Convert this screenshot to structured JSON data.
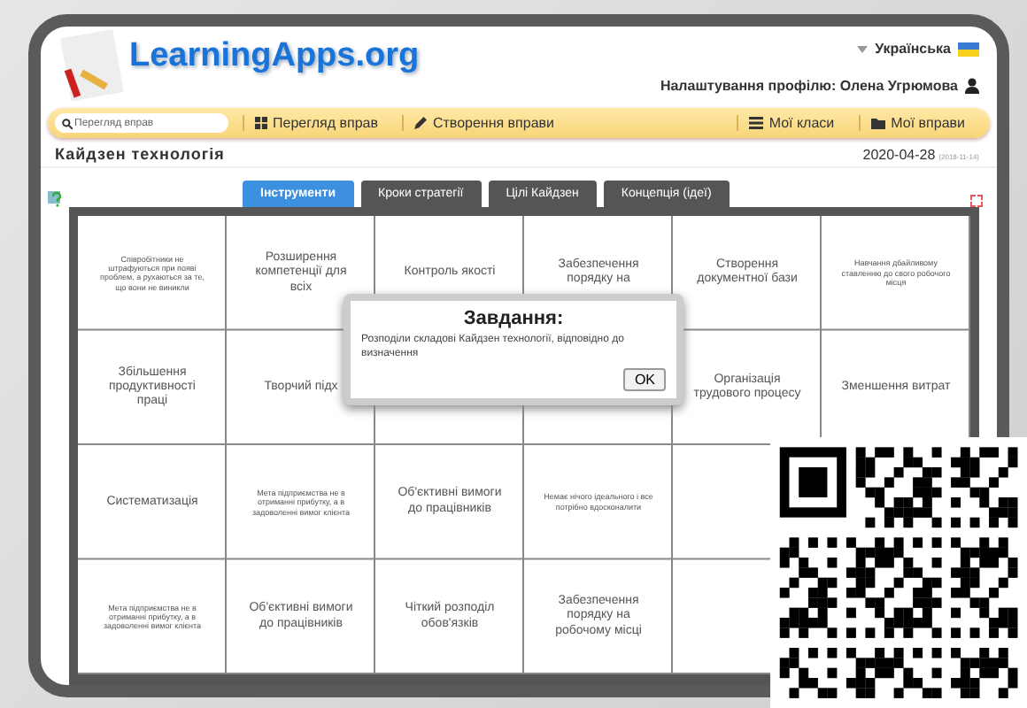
{
  "header": {
    "logo": "LearningApps.org",
    "language": "Українська",
    "profile": "Налаштування профілю: Олена Угрюмова"
  },
  "nav": {
    "search": {
      "placeholder": "Перегляд вправ"
    },
    "links": [
      {
        "label": "Перегляд вправ",
        "kind": "grid"
      },
      {
        "label": "Створення вправи",
        "kind": "pencil"
      },
      {
        "label": "Мої класи",
        "kind": "list"
      },
      {
        "label": "Мої вправи",
        "kind": "folder"
      }
    ]
  },
  "page": {
    "title": "Кайдзен технологія",
    "date": "2020-04-28",
    "created": "(2018-11-14)"
  },
  "tabs": [
    {
      "label": "Інструменти",
      "selected": true
    },
    {
      "label": "Кроки стратегії",
      "selected": false
    },
    {
      "label": "Цілі Кайдзен",
      "selected": false
    },
    {
      "label": "Концепція (ідеї)",
      "selected": false
    }
  ],
  "puzzle": [
    [
      {
        "text": "Співробітники не штрафуються при появі проблем, а рухаються за те, що вони не виникли",
        "kind": "small"
      },
      {
        "text": "Розширення компетенції для всіх",
        "kind": "normal"
      },
      {
        "text": "Контроль якості",
        "kind": "normal"
      },
      {
        "text": "Забезпечення порядку на",
        "kind": "normal"
      },
      {
        "text": "Створення документної бази",
        "kind": "normal"
      },
      {
        "text": "Навчання дбайливому ставленню до свого робочого місця",
        "kind": "small"
      }
    ],
    [
      {
        "text": "Збільшення продуктивності праці",
        "kind": "normal"
      },
      {
        "text": "Творчий підх",
        "kind": "normal"
      },
      {
        "kind": "covered"
      },
      {
        "kind": "covered"
      },
      {
        "text": "Організація трудового процесу",
        "kind": "normal"
      },
      {
        "text": "Зменшення витрат",
        "kind": "normal"
      }
    ],
    [
      {
        "text": "Систематизація",
        "kind": "normal"
      },
      {
        "text": "Мета підприємства не в отриманні прибутку, а в задоволенні вимог клієнта",
        "kind": "small"
      },
      {
        "text": "Об'єктивні вимоги до працівників",
        "kind": "normal"
      },
      {
        "text": "Немає нічого ідеального і все потрібно вдосконалити",
        "kind": "small"
      },
      {
        "kind": "covered"
      },
      {
        "kind": "covered"
      }
    ],
    [
      {
        "text": "Мета підприємства не в отриманні прибутку, а в задоволенні вимог клієнта",
        "kind": "small"
      },
      {
        "text": "Об'єктивні вимоги до працівників",
        "kind": "normal"
      },
      {
        "text": "Чіткий розподіл обов'язків",
        "kind": "normal"
      },
      {
        "text": "Забезпечення порядку на робочому місці",
        "kind": "normal"
      },
      {
        "kind": "covered"
      },
      {
        "kind": "covered"
      }
    ]
  ],
  "dialog": {
    "title": "Завдання:",
    "message": "Розподіли складові Кайдзен технології, відповідно до визначення",
    "button": "OK"
  }
}
